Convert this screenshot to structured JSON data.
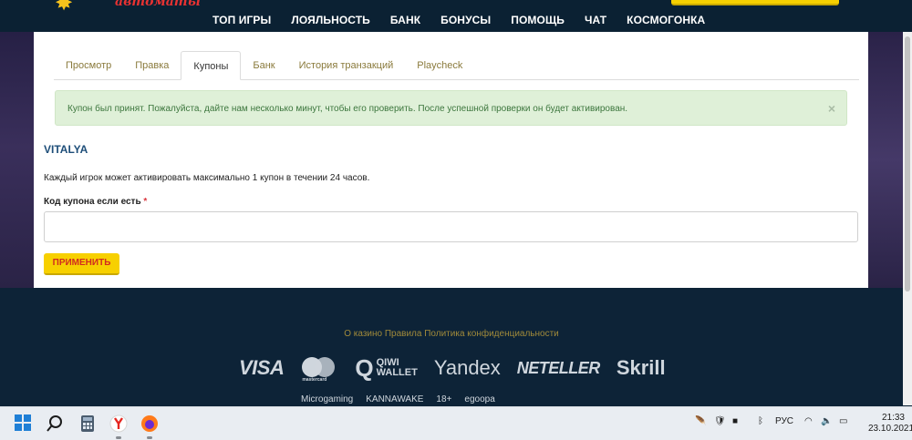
{
  "header": {
    "logo_text": "автоматы",
    "nav": [
      "ТОП ИГРЫ",
      "ЛОЯЛЬНОСТЬ",
      "БАНК",
      "БОНУСЫ",
      "ПОМОЩЬ",
      "ЧАТ",
      "КОСМОГОНКА"
    ]
  },
  "tabs": [
    "Просмотр",
    "Правка",
    "Купоны",
    "Банк",
    "История транзакций",
    "Playcheck"
  ],
  "active_tab": "Купоны",
  "alert": {
    "text": "Купон был принят. Пожалуйста, дайте нам несколько минут, чтобы его проверить. После успешной проверки он будет активирован.",
    "close": "×"
  },
  "coupon": {
    "title": "VITALYA",
    "description": "Каждый игрок может активировать максимально 1 купон в течении 24 часов.",
    "label": "Код купона если есть",
    "required_mark": "*",
    "input_value": "",
    "apply_label": "ПРИМЕНИТЬ"
  },
  "footer": {
    "links": "О казино Правила Политика конфиденциальности",
    "payments": {
      "visa": "VISA",
      "mastercard": "mastercard",
      "qiwi_1": "QIWI",
      "qiwi_2": "WALLET",
      "yandex": "Yandex",
      "neteller": "NETELLER",
      "skrill": "Skrill"
    },
    "providers": [
      "Microgaming",
      "KANNAWAKE",
      "18+",
      "egoopa"
    ]
  },
  "taskbar": {
    "lang": "РУС",
    "time": "21:33",
    "date": "23.10.2021"
  },
  "colors": {
    "nav_bg": "#0b2133",
    "accent_yellow": "#f7d000",
    "tab_text": "#8a7a3c",
    "alert_bg": "#dff0d8",
    "alert_text": "#3c763d",
    "title_blue": "#1e4e79",
    "button_text": "#d12b1f"
  }
}
